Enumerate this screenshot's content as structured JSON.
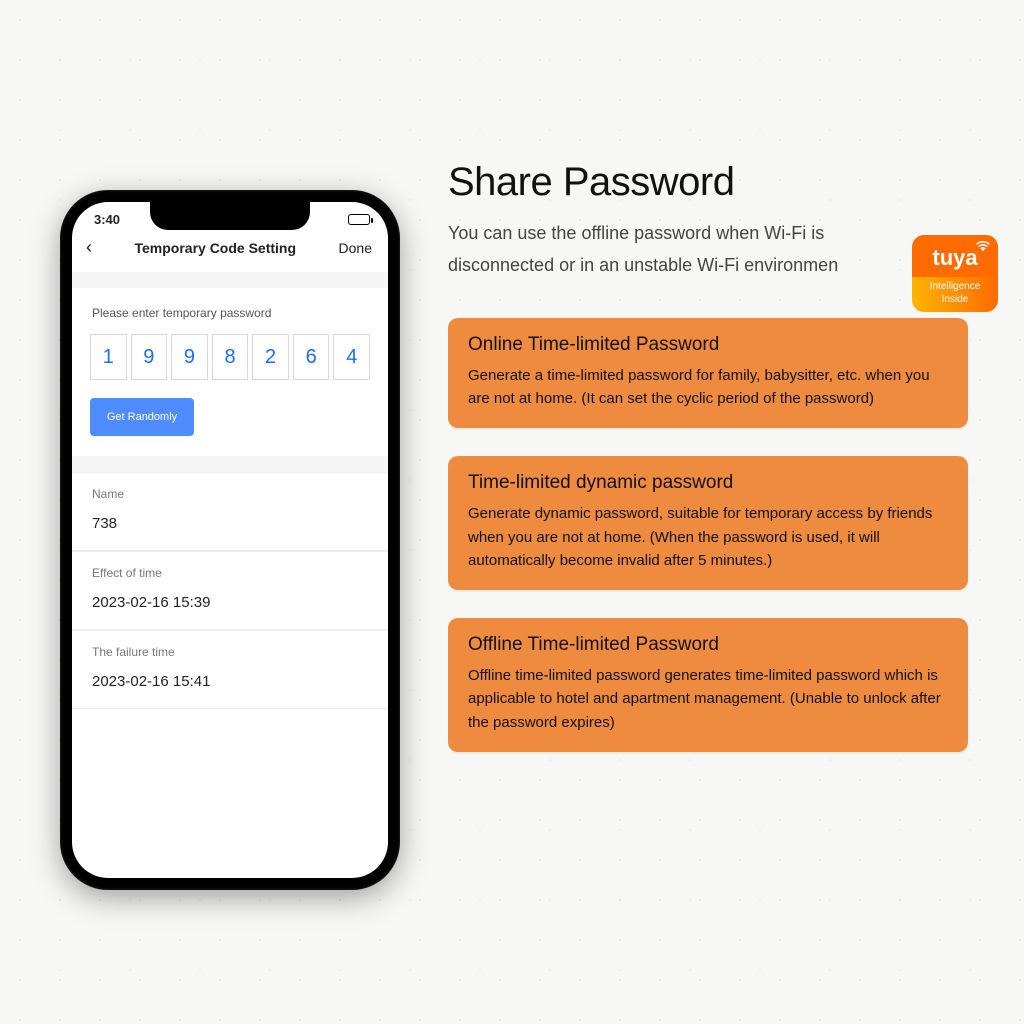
{
  "statusbar": {
    "time": "3:40"
  },
  "nav": {
    "title": "Temporary Code Setting",
    "done": "Done"
  },
  "form": {
    "prompt": "Please enter temporary password",
    "code": [
      "1",
      "9",
      "9",
      "8",
      "2",
      "6",
      "4"
    ],
    "random_btn": "Get Randomly",
    "name_label": "Name",
    "name_value": "738",
    "effect_label": "Effect of time",
    "effect_value": "2023-02-16 15:39",
    "failure_label": "The failure time",
    "failure_value": "2023-02-16 15:41"
  },
  "headline": "Share Password",
  "subtext": "You can use the offline password when Wi-Fi is disconnected or in an unstable Wi-Fi environmen",
  "tuya": {
    "brand": "tuya",
    "tagline": "Intelligence Inside"
  },
  "cards": [
    {
      "title": "Online Time-limited Password",
      "body": "Generate a time-limited password for family, babysitter, etc. when you are not at home.  (It can set the cyclic period of the password)"
    },
    {
      "title": "Time-limited dynamic password",
      "body": "Generate dynamic password, suitable for temporary access by friends when you are not at home. (When the password is used, it will automatically become invalid after 5 minutes.)"
    },
    {
      "title": "Offline Time-limited Password",
      "body": "Offline time-limited password generates time-limited password which is applicable to hotel and apartment management. (Unable to unlock after the password expires)"
    }
  ]
}
